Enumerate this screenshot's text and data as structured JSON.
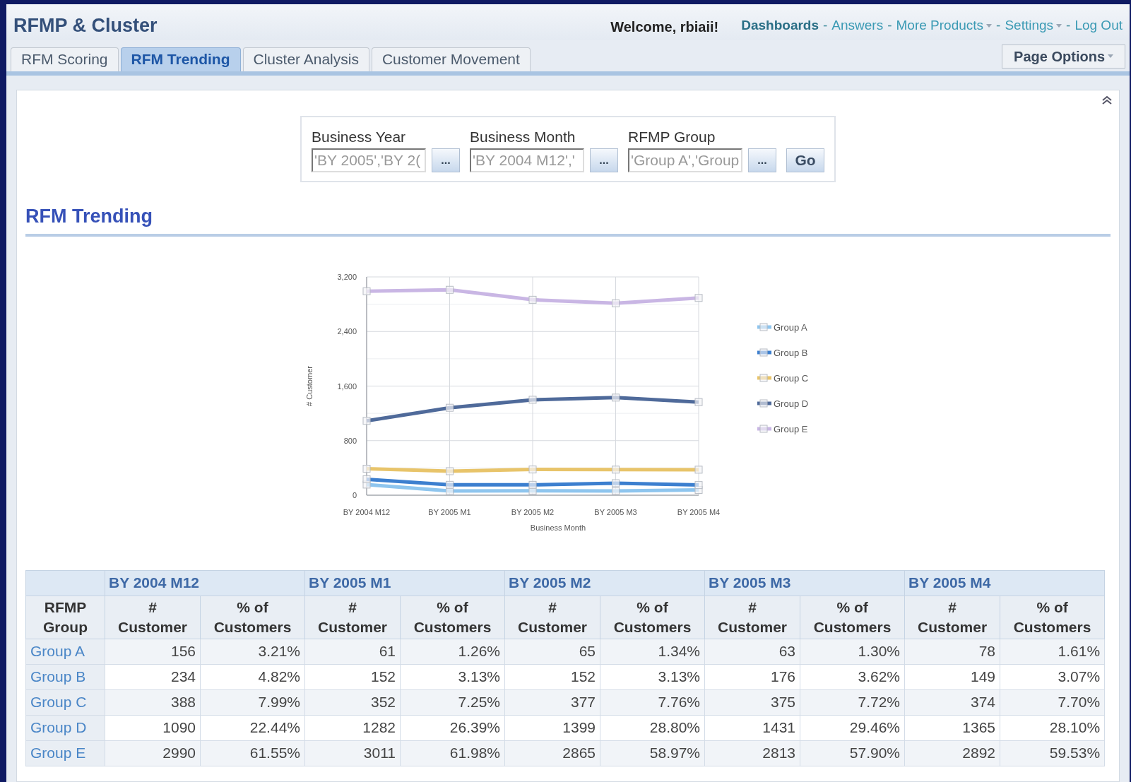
{
  "header": {
    "title": "RFMP & Cluster",
    "welcome": "Welcome, rbiaii!",
    "links": [
      {
        "label": "Dashboards",
        "current": true,
        "has_menu": false
      },
      {
        "prefix": "-",
        "label": "Answers",
        "current": false,
        "has_menu": false
      },
      {
        "prefix": "-",
        "label": "More Products",
        "current": false,
        "has_menu": true
      },
      {
        "prefix": "-",
        "label": "Settings",
        "current": false,
        "has_menu": true
      },
      {
        "prefix": "-",
        "label": "Log Out",
        "current": false,
        "has_menu": false
      }
    ]
  },
  "tabs": [
    {
      "label": "RFM Scoring",
      "selected": false
    },
    {
      "label": "RFM Trending",
      "selected": true
    },
    {
      "label": "Cluster Analysis",
      "selected": false
    },
    {
      "label": "Customer Movement",
      "selected": false
    }
  ],
  "page_options": {
    "label": "Page Options"
  },
  "filters": {
    "prompts": [
      {
        "label": "Business Year",
        "value": "'BY 2005','BY 2(",
        "button": "..."
      },
      {
        "label": "Business Month",
        "value": "'BY 2004 M12','",
        "button": "..."
      },
      {
        "label": "RFMP Group",
        "value": "'Group A','Group",
        "button": "..."
      }
    ],
    "go": "Go"
  },
  "section_title": "RFM Trending",
  "chart_data": {
    "type": "line",
    "xlabel": "Business Month",
    "ylabel": "# Customer",
    "categories": [
      "BY 2004 M12",
      "BY 2005 M1",
      "BY 2005 M2",
      "BY 2005 M3",
      "BY 2005 M4"
    ],
    "ylim": [
      0,
      3200
    ],
    "grid": true,
    "legend": true,
    "yticks": [
      {
        "value": 0,
        "label": "0"
      },
      {
        "value": 800,
        "label": "800"
      },
      {
        "value": 1600,
        "label": "1,600"
      },
      {
        "value": 2400,
        "label": "2,400"
      },
      {
        "value": 3200,
        "label": "3,200"
      }
    ],
    "series": [
      {
        "name": "Group A",
        "color": "#8ec5ee",
        "marker": "square",
        "values": [
          156,
          61,
          65,
          63,
          78
        ]
      },
      {
        "name": "Group B",
        "color": "#3c7fcf",
        "marker": "square",
        "values": [
          234,
          152,
          152,
          176,
          149
        ]
      },
      {
        "name": "Group C",
        "color": "#e8c46a",
        "marker": "square",
        "values": [
          388,
          352,
          377,
          375,
          374
        ]
      },
      {
        "name": "Group D",
        "color": "#4f6a9a",
        "marker": "square",
        "values": [
          1090,
          1282,
          1399,
          1431,
          1365
        ]
      },
      {
        "name": "Group E",
        "color": "#c9b6e4",
        "marker": "square",
        "values": [
          2990,
          3011,
          2865,
          2813,
          2892
        ]
      }
    ]
  },
  "table": {
    "group_header": "RFMP Group",
    "months": [
      {
        "label": "BY 2004 M12",
        "columns": [
          "# Customer",
          "% of Customers"
        ]
      },
      {
        "label": "BY 2005 M1",
        "columns": [
          "# Customer",
          "% of Customers"
        ]
      },
      {
        "label": "BY 2005 M2",
        "columns": [
          "# Customer",
          "% of Customers"
        ]
      },
      {
        "label": "BY 2005 M3",
        "columns": [
          "# Customer",
          "% of Customers"
        ]
      },
      {
        "label": "BY 2005 M4",
        "columns": [
          "# Customer",
          "% of Customers"
        ]
      }
    ],
    "rows": [
      {
        "group": "Group A",
        "cells": [
          "156",
          "3.21%",
          "61",
          "1.26%",
          "65",
          "1.34%",
          "63",
          "1.30%",
          "78",
          "1.61%"
        ]
      },
      {
        "group": "Group B",
        "cells": [
          "234",
          "4.82%",
          "152",
          "3.13%",
          "152",
          "3.13%",
          "176",
          "3.62%",
          "149",
          "3.07%"
        ]
      },
      {
        "group": "Group C",
        "cells": [
          "388",
          "7.99%",
          "352",
          "7.25%",
          "377",
          "7.76%",
          "375",
          "7.72%",
          "374",
          "7.70%"
        ]
      },
      {
        "group": "Group D",
        "cells": [
          "1090",
          "22.44%",
          "1282",
          "26.39%",
          "1399",
          "28.80%",
          "1431",
          "29.46%",
          "1365",
          "28.10%"
        ]
      },
      {
        "group": "Group E",
        "cells": [
          "2990",
          "61.55%",
          "3011",
          "61.98%",
          "2865",
          "58.97%",
          "2813",
          "57.90%",
          "2892",
          "59.53%"
        ]
      }
    ]
  }
}
